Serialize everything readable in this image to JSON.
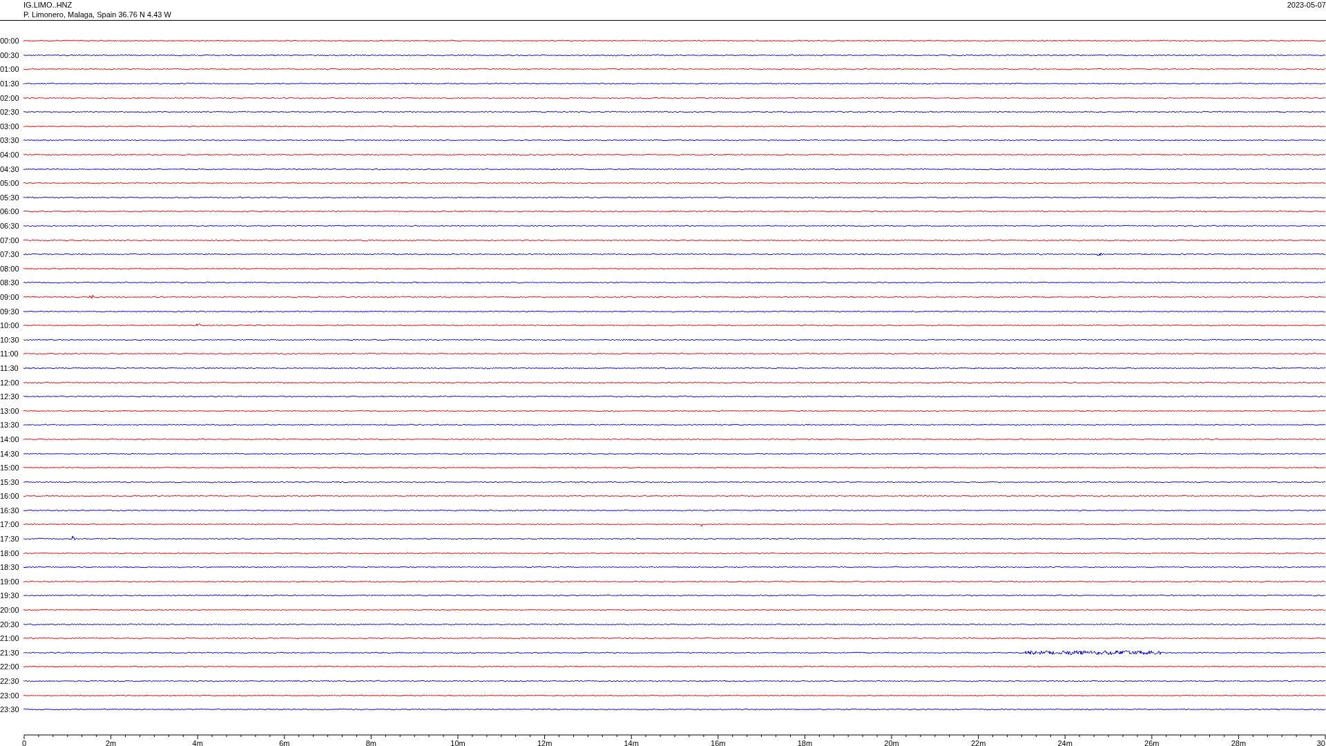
{
  "header": {
    "channel": "IG.LIMO..HNZ",
    "location": "P. Limonero, Malaga, Spain  36.76 N 4.43 W",
    "date": "2023-05-07"
  },
  "rows": [
    {
      "label": "00:00",
      "color": "#ff0000"
    },
    {
      "label": "00:30",
      "color": "#0000ff"
    },
    {
      "label": "01:00",
      "color": "#ff0000"
    },
    {
      "label": "01:30",
      "color": "#0000ff"
    },
    {
      "label": "02:00",
      "color": "#ff0000"
    },
    {
      "label": "02:30",
      "color": "#0000ff"
    },
    {
      "label": "03:00",
      "color": "#ff0000"
    },
    {
      "label": "03:30",
      "color": "#0000ff"
    },
    {
      "label": "04:00",
      "color": "#ff0000"
    },
    {
      "label": "04:30",
      "color": "#0000ff"
    },
    {
      "label": "05:00",
      "color": "#ff0000"
    },
    {
      "label": "05:30",
      "color": "#0000ff"
    },
    {
      "label": "06:00",
      "color": "#ff0000"
    },
    {
      "label": "06:30",
      "color": "#0000ff"
    },
    {
      "label": "07:00",
      "color": "#ff0000"
    },
    {
      "label": "07:30",
      "color": "#0000ff"
    },
    {
      "label": "08:00",
      "color": "#ff0000"
    },
    {
      "label": "08:30",
      "color": "#0000ff"
    },
    {
      "label": "09:00",
      "color": "#ff0000"
    },
    {
      "label": "09:30",
      "color": "#0000ff"
    },
    {
      "label": "10:00",
      "color": "#ff0000"
    },
    {
      "label": "10:30",
      "color": "#0000ff"
    },
    {
      "label": "11:00",
      "color": "#ff0000"
    },
    {
      "label": "11:30",
      "color": "#0000ff"
    },
    {
      "label": "12:00",
      "color": "#ff0000"
    },
    {
      "label": "12:30",
      "color": "#0000ff"
    },
    {
      "label": "13:00",
      "color": "#ff0000"
    },
    {
      "label": "13:30",
      "color": "#0000ff"
    },
    {
      "label": "14:00",
      "color": "#ff0000"
    },
    {
      "label": "14:30",
      "color": "#0000ff"
    },
    {
      "label": "15:00",
      "color": "#ff0000"
    },
    {
      "label": "15:30",
      "color": "#0000ff"
    },
    {
      "label": "16:00",
      "color": "#ff0000"
    },
    {
      "label": "16:30",
      "color": "#0000ff"
    },
    {
      "label": "17:00",
      "color": "#ff0000"
    },
    {
      "label": "17:30",
      "color": "#0000ff"
    },
    {
      "label": "18:00",
      "color": "#ff0000"
    },
    {
      "label": "18:30",
      "color": "#0000ff"
    },
    {
      "label": "19:00",
      "color": "#ff0000"
    },
    {
      "label": "19:30",
      "color": "#0000ff"
    },
    {
      "label": "20:00",
      "color": "#ff0000"
    },
    {
      "label": "20:30",
      "color": "#0000ff"
    },
    {
      "label": "21:00",
      "color": "#ff0000"
    },
    {
      "label": "21:30",
      "color": "#0000ff"
    },
    {
      "label": "22:00",
      "color": "#ff0000"
    },
    {
      "label": "22:30",
      "color": "#0000ff"
    },
    {
      "label": "23:00",
      "color": "#ff0000"
    },
    {
      "label": "23:30",
      "color": "#0000ff"
    }
  ],
  "x_axis": {
    "labels": [
      "0",
      "2m",
      "4m",
      "6m",
      "8m",
      "10m",
      "12m",
      "14m",
      "16m",
      "18m",
      "20m",
      "22m",
      "24m",
      "26m",
      "28m",
      "30"
    ]
  }
}
